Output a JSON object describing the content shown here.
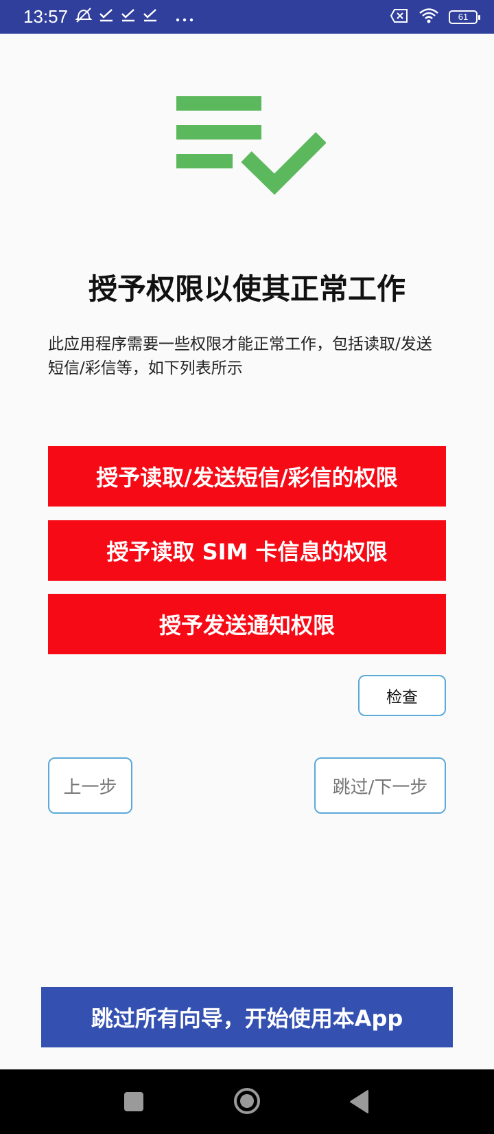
{
  "status_bar": {
    "time": "13:57",
    "battery": "61",
    "icons": [
      "mute-icon",
      "check-icon",
      "check-icon",
      "check-icon",
      "more-dots-icon",
      "sim-x-icon",
      "wifi-icon",
      "battery-icon"
    ]
  },
  "hero": {
    "icon": "list-check-icon",
    "color": "#5cb85c"
  },
  "title": "授予权限以使其正常工作",
  "description": "此应用程序需要一些权限才能正常工作，包括读取/发送短信/彩信等，如下列表所示",
  "permissions": [
    {
      "label": "授予读取/发送短信/彩信的权限"
    },
    {
      "label": "授予读取 SIM 卡信息的权限"
    },
    {
      "label": "授予发送通知权限"
    }
  ],
  "check_label": "检查",
  "nav": {
    "prev_label": "上一步",
    "next_label": "跳过/下一步"
  },
  "skip_all_label": "跳过所有向导，开始使用本App",
  "colors": {
    "status_bar": "#2f3f9b",
    "permission_button": "#f50a15",
    "skip_all_button": "#3451b2",
    "outline": "#5aa9d8"
  }
}
